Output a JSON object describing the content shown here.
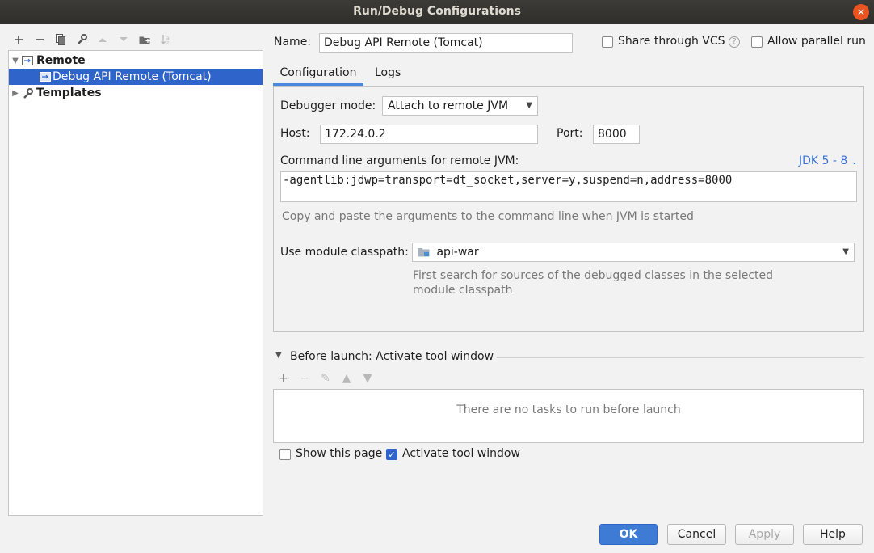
{
  "window": {
    "title": "Run/Debug Configurations"
  },
  "toolbar": {
    "icons": [
      "add-icon",
      "remove-icon",
      "copy-icon",
      "wrench-icon",
      "move-up-icon",
      "move-down-icon",
      "new-folder-icon",
      "sort-icon"
    ]
  },
  "tree": {
    "group_label": "Remote",
    "item_label": "Debug API Remote (Tomcat)",
    "templates_label": "Templates"
  },
  "header": {
    "name_label": "Name:",
    "name_value": "Debug API Remote (Tomcat)",
    "share_vcs_label": "Share through VCS",
    "help_glyph": "?",
    "allow_parallel_label": "Allow parallel run"
  },
  "tabs": [
    {
      "label": "Configuration"
    },
    {
      "label": "Logs"
    }
  ],
  "config": {
    "debugger_mode_label": "Debugger mode:",
    "debugger_mode_value": "Attach to remote JVM",
    "host_label": "Host:",
    "host_value": "172.24.0.2",
    "port_label": "Port:",
    "port_value": "8000",
    "cmdline_label": "Command line arguments for remote JVM:",
    "jdk_link": "JDK 5 - 8",
    "cmdline_value": "-agentlib:jdwp=transport=dt_socket,server=y,suspend=n,address=8000",
    "cmdline_hint": "Copy and paste the arguments to the command line when JVM is started",
    "module_label": "Use module classpath:",
    "module_value": "api-war",
    "module_hint_1": "First search for sources of the debugged classes in the selected",
    "module_hint_2": "module classpath"
  },
  "before_launch": {
    "title": "Before launch: Activate tool window",
    "empty_text": "There are no tasks to run before launch",
    "show_page_label": "Show this page",
    "activate_label": "Activate tool window"
  },
  "buttons": {
    "ok": "OK",
    "cancel": "Cancel",
    "apply": "Apply",
    "help": "Help"
  },
  "colors": {
    "accent": "#2f65ca",
    "link": "#3b73d6",
    "close": "#e95420"
  }
}
